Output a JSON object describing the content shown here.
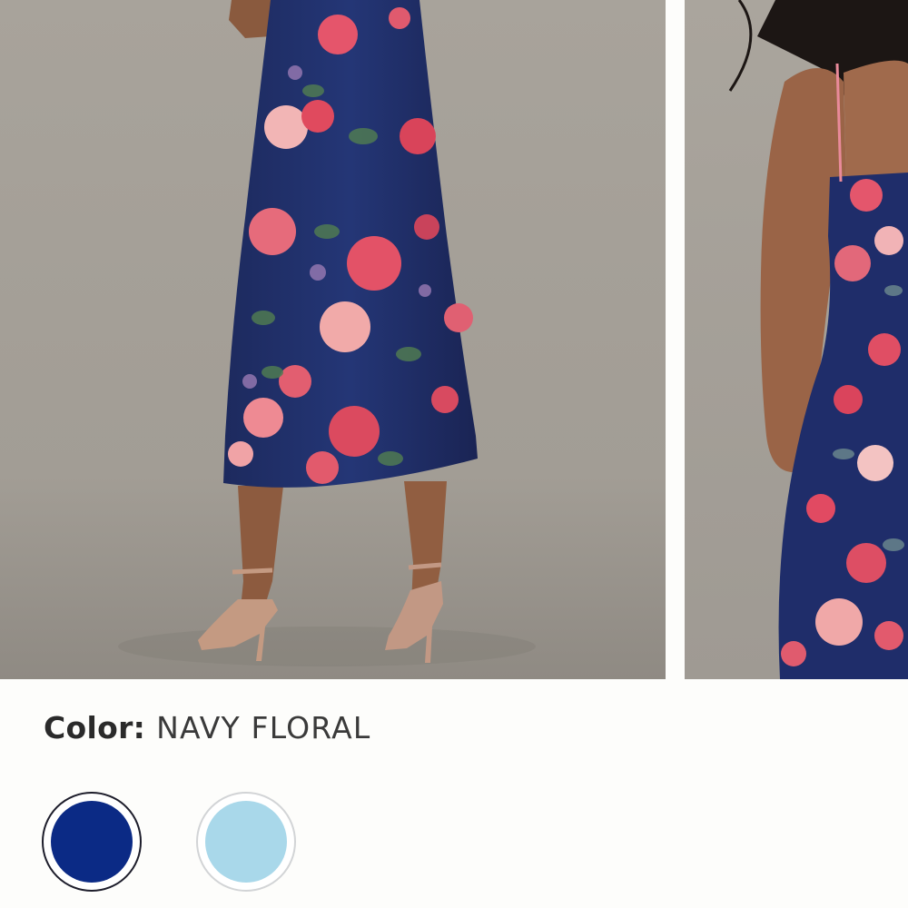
{
  "product": {
    "color_label": "Color:",
    "color_value": "NAVY FLORAL"
  },
  "gallery": {
    "images": [
      {
        "name": "dress-back-view",
        "description_icon": "photo"
      },
      {
        "name": "dress-side-view",
        "description_icon": "photo"
      }
    ]
  },
  "swatches": [
    {
      "name": "navy-floral",
      "color": "#0b2a85",
      "selected": true
    },
    {
      "name": "light-blue",
      "color": "#a9d8ea",
      "selected": false
    }
  ]
}
